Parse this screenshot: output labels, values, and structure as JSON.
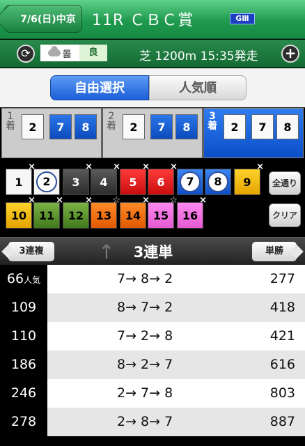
{
  "header": {
    "back_label": "7/6(日)中京",
    "race_title": "11R ＣＢＣ賞",
    "grade": "GⅢ"
  },
  "info": {
    "weather": "曇",
    "track_condition": "良",
    "race_info": "芝 1200m 15:35発走"
  },
  "segments": {
    "free_label": "自由選択",
    "popular_label": "人気順"
  },
  "finish_positions": [
    {
      "label": "1着",
      "picks": [
        "2",
        "7",
        "8"
      ]
    },
    {
      "label": "2着",
      "picks": [
        "2",
        "7",
        "8"
      ]
    },
    {
      "label": "3着",
      "picks": [
        "2",
        "7",
        "8"
      ]
    }
  ],
  "horses": {
    "row1": [
      "1",
      "2",
      "3",
      "4",
      "5",
      "6",
      "7",
      "8",
      "9"
    ],
    "row2": [
      "10",
      "11",
      "12",
      "13",
      "14",
      "15",
      "16"
    ],
    "marks": {
      "x": "×",
      "star": "☆"
    }
  },
  "buttons": {
    "all_label": "全通り",
    "clear_label": "クリア"
  },
  "bet_type": {
    "prev": "3連複",
    "current": "3連単",
    "next": "単勝"
  },
  "results": [
    {
      "rank": "66",
      "rank_suffix": "人気",
      "combo": "7→ 8→ 2",
      "odds": "277"
    },
    {
      "rank": "109",
      "rank_suffix": "",
      "combo": "8→ 7→ 2",
      "odds": "418"
    },
    {
      "rank": "110",
      "rank_suffix": "",
      "combo": "7→ 2→ 8",
      "odds": "421"
    },
    {
      "rank": "186",
      "rank_suffix": "",
      "combo": "8→ 2→ 7",
      "odds": "616"
    },
    {
      "rank": "246",
      "rank_suffix": "",
      "combo": "2→ 7→ 8",
      "odds": "803"
    },
    {
      "rank": "278",
      "rank_suffix": "",
      "combo": "2→ 8→ 7",
      "odds": "887"
    }
  ]
}
